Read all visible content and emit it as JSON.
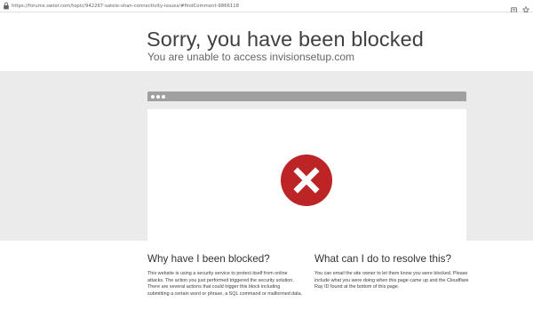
{
  "address_bar": {
    "url": "https://forums.swtor.com/topic/942267-satele-shan-connectivity-issues/#findComment-9866118",
    "icons": [
      "lock-icon",
      "reader-icon",
      "star-icon"
    ]
  },
  "headline": {
    "title": "Sorry, you have been blocked",
    "subtitle": "You are unable to access invisionsetup.com"
  },
  "illustration": {
    "icon": "error-x-icon",
    "colors": {
      "error_red": "#bd2426",
      "band_gray": "#ebebeb",
      "browser_bar_gray": "#a0a0a0"
    }
  },
  "why": {
    "heading": "Why have I been blocked?",
    "body": "This website is using a security service to protect itself from online attacks. The action you just performed triggered the security solution. There are several actions that could trigger this block including submitting a certain word or phrase, a SQL command or malformed data."
  },
  "resolve": {
    "heading": "What can I do to resolve this?",
    "body": "You can email the site owner to let them know you were blocked. Please include what you were doing when this page came up and the Cloudflare Ray ID found at the bottom of this page."
  }
}
